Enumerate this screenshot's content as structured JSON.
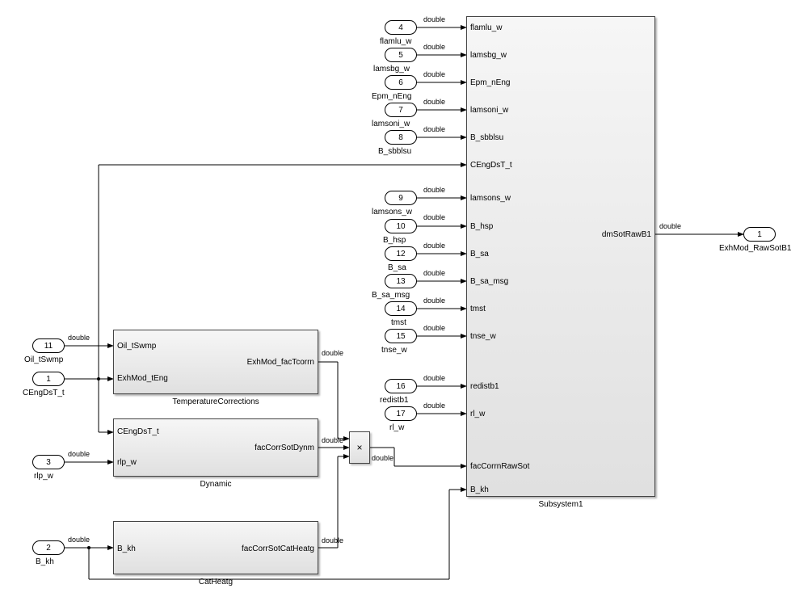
{
  "datatype_label": "double",
  "inports": {
    "p1": {
      "num": "1",
      "name": "CEngDsT_t"
    },
    "p2": {
      "num": "2",
      "name": "B_kh"
    },
    "p3": {
      "num": "3",
      "name": "rlp_w"
    },
    "p4": {
      "num": "4",
      "name": "flamlu_w"
    },
    "p5": {
      "num": "5",
      "name": "lamsbg_w"
    },
    "p6": {
      "num": "6",
      "name": "Epm_nEng"
    },
    "p7": {
      "num": "7",
      "name": "lamsoni_w"
    },
    "p8": {
      "num": "8",
      "name": "B_sbblsu"
    },
    "p9": {
      "num": "9",
      "name": "lamsons_w"
    },
    "p10": {
      "num": "10",
      "name": "B_hsp"
    },
    "p11": {
      "num": "11",
      "name": "Oil_tSwmp"
    },
    "p12": {
      "num": "12",
      "name": "B_sa"
    },
    "p13": {
      "num": "13",
      "name": "B_sa_msg"
    },
    "p14": {
      "num": "14",
      "name": "tmst"
    },
    "p15": {
      "num": "15",
      "name": "tnse_w"
    },
    "p16": {
      "num": "16",
      "name": "redistb1"
    },
    "p17": {
      "num": "17",
      "name": "rl_w"
    }
  },
  "outports": {
    "o1": {
      "num": "1",
      "name": "ExhMod_RawSotB1"
    }
  },
  "blocks": {
    "tempCorr": {
      "name": "TemperatureCorrections",
      "in1": "Oil_tSwmp",
      "in2": "ExhMod_tEng",
      "out1": "ExhMod_facTcorrn"
    },
    "dynamic": {
      "name": "Dynamic",
      "in1": "CEngDsT_t",
      "in2": "rlp_w",
      "out1": "facCorrSotDynm"
    },
    "catHeatg": {
      "name": "CatHeatg",
      "in1": "B_kh",
      "out1": "facCorrSotCatHeatg"
    },
    "subsystem1": {
      "name": "Subsystem1",
      "ports_left": [
        "flamlu_w",
        "lamsbg_w",
        "Epm_nEng",
        "lamsoni_w",
        "B_sbblsu",
        "CEngDsT_t",
        "lamsons_w",
        "B_hsp",
        "B_sa",
        "B_sa_msg",
        "tmst",
        "tnse_w",
        "redistb1",
        "rl_w",
        "facCorrnRawSot",
        "B_kh"
      ],
      "out1": "dmSotRawB1"
    }
  },
  "product_symbol": "×"
}
